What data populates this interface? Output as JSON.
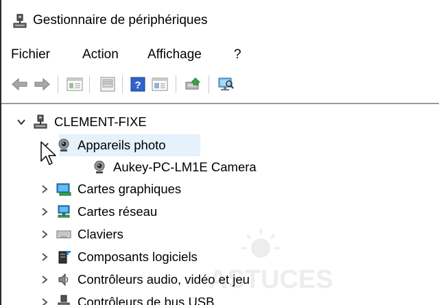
{
  "window": {
    "title": "Gestionnaire de périphériques"
  },
  "menu": {
    "items": [
      {
        "label": "Fichier"
      },
      {
        "label": "Action"
      },
      {
        "label": "Affichage"
      },
      {
        "label": "?"
      }
    ]
  },
  "toolbar": {
    "icons": [
      "back-arrow-icon",
      "forward-arrow-icon",
      "properties-icon",
      "show-hidden-icon",
      "help-icon",
      "view-icon",
      "update-driver-icon",
      "scan-hardware-icon"
    ]
  },
  "tree": {
    "root": {
      "label": "CLEMENT-FIXE",
      "expanded": true
    },
    "items": [
      {
        "label": "Appareils photo",
        "expanded": true,
        "selected": true
      },
      {
        "label": "Aukey-PC-LM1E Camera",
        "child": true
      },
      {
        "label": "Cartes graphiques",
        "expanded": false
      },
      {
        "label": "Cartes réseau",
        "expanded": false
      },
      {
        "label": "Claviers",
        "expanded": false
      },
      {
        "label": "Composants logiciels",
        "expanded": false
      },
      {
        "label": "Contrôleurs audio, vidéo et jeu",
        "expanded": false
      },
      {
        "label": "Contrôleurs de bus USB",
        "expanded": false
      }
    ]
  },
  "watermark": {
    "text": "ASTUCES"
  },
  "colors": {
    "selection": "#e5f1fb",
    "divider": "#9a9a9a",
    "accent": "#1e78c8"
  }
}
